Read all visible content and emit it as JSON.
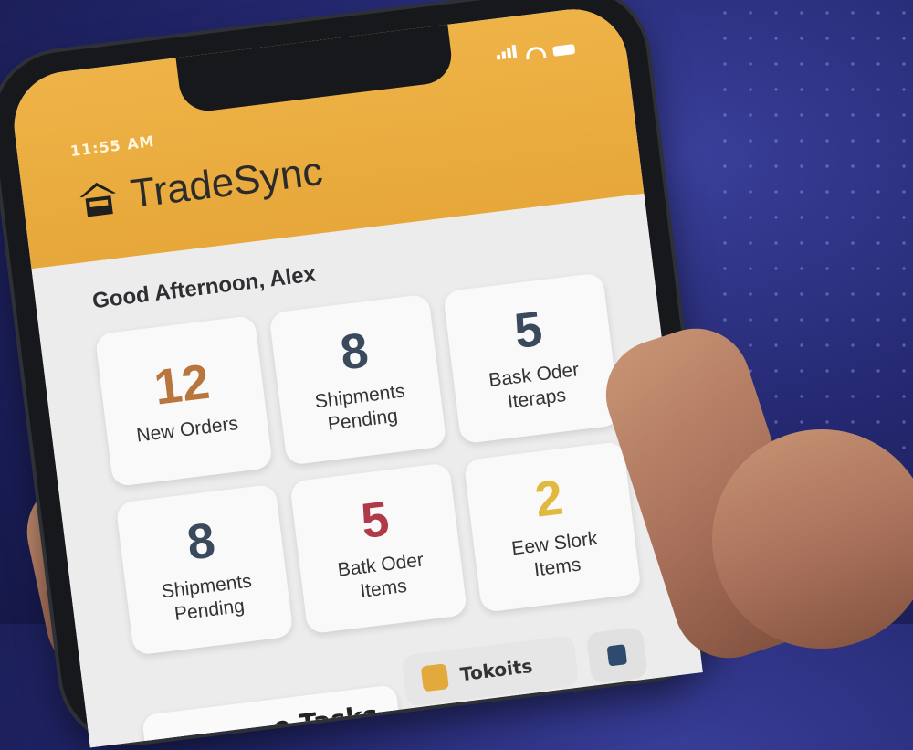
{
  "status": {
    "time": "11:55 AM"
  },
  "app": {
    "title": "TradeSync",
    "logo_icon": "warehouse-icon"
  },
  "greeting": "Good Afternoon, Alex",
  "cards": [
    {
      "value": "12",
      "label": "New Orders",
      "color": "#b9753e"
    },
    {
      "value": "8",
      "label": "Shipments Pending",
      "color": "#3a4a5c"
    },
    {
      "value": "5",
      "label": "Bask Oder Iteraps",
      "color": "#3a4a5c"
    },
    {
      "value": "8",
      "label": "Shipments Pending",
      "color": "#3a4a5c"
    },
    {
      "value": "5",
      "label": "Batk Oder Items",
      "color": "#b03a48"
    },
    {
      "value": "2",
      "label": "Eew Slork Items",
      "color": "#e0b93e"
    }
  ],
  "bottom": {
    "tasks_label": "...e Tasks",
    "tab_label": "Tokoits",
    "tab_icon": "box-icon",
    "side_icon": "info-icon"
  },
  "colors": {
    "header": "#e7a73a",
    "background": "#23276e"
  }
}
